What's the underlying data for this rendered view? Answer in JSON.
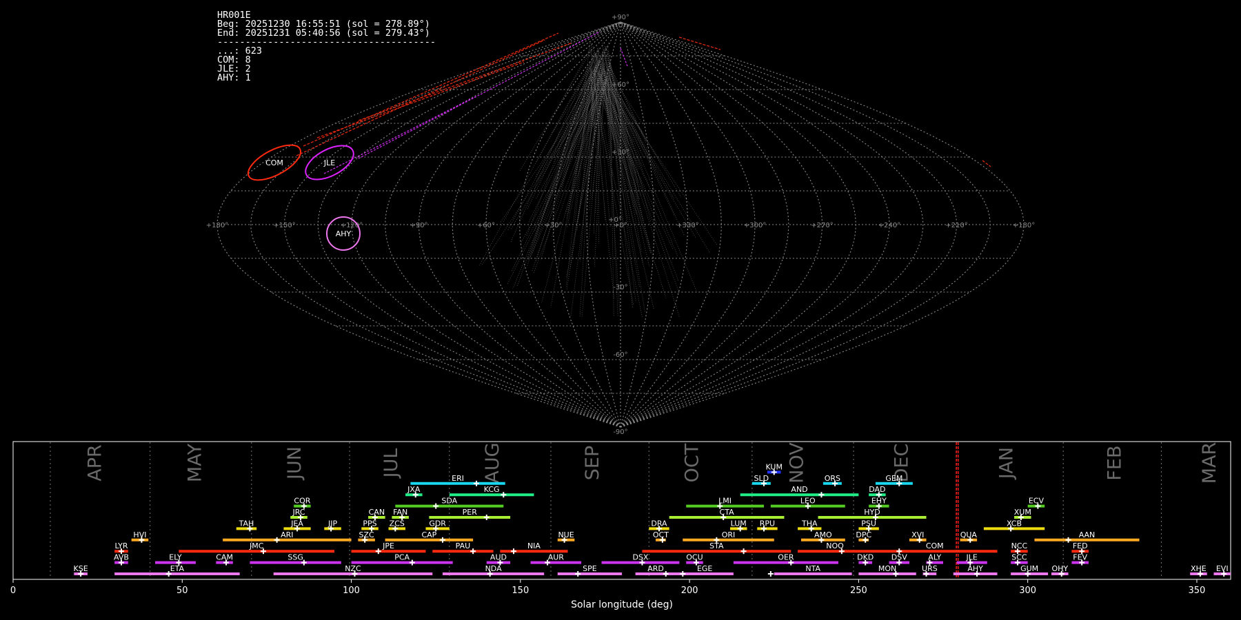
{
  "stats": {
    "lines": [
      "HR001E",
      "Beg: 20251230 16:55:51 (sol = 278.89°)",
      "End: 20251231 05:40:56 (sol = 279.43°)",
      "---------------------------------------",
      "...: 623",
      "COM: 8",
      "JLE: 2",
      "AHY: 1"
    ]
  },
  "chart_data": [
    {
      "type": "sky-map-sinusoidal",
      "lat_ticks": [
        "+90°",
        "+60°",
        "+30°",
        "+0°",
        "-30°",
        "-60°",
        "-90°"
      ],
      "lon_ticks": [
        "+180°",
        "+150°",
        "+120°",
        "+90°",
        "+60°",
        "+30°",
        "+0°",
        "+330°",
        "+300°",
        "+270°",
        "+240°",
        "+210°",
        "+180°"
      ],
      "grid": true,
      "radiants": [
        {
          "code": "COM",
          "color": "#ff2a10"
        },
        {
          "code": "JLE",
          "color": "#dd22ff"
        },
        {
          "code": "AHY",
          "color": "#ee77ee"
        }
      ]
    },
    {
      "type": "timeline",
      "xlabel": "Solar longitude (deg)",
      "xlim": [
        0,
        360
      ],
      "xticks": [
        0,
        50,
        100,
        150,
        200,
        250,
        300,
        350
      ],
      "current_marker": [
        278.89,
        279.43
      ],
      "months": [
        {
          "name": "APR",
          "center": 24.5
        },
        {
          "name": "MAY",
          "center": 54
        },
        {
          "name": "JUN",
          "center": 83.5
        },
        {
          "name": "JUL",
          "center": 112
        },
        {
          "name": "AUG",
          "center": 142
        },
        {
          "name": "SEP",
          "center": 171.5
        },
        {
          "name": "OCT",
          "center": 201
        },
        {
          "name": "NOV",
          "center": 232
        },
        {
          "name": "DEC",
          "center": 263
        },
        {
          "name": "JAN",
          "center": 294
        },
        {
          "name": "FEB",
          "center": 326
        },
        {
          "name": "MAR",
          "center": 354
        }
      ],
      "month_boundaries": [
        11,
        40.5,
        70.5,
        99.5,
        129,
        159,
        188,
        218.5,
        248.5,
        279,
        310.5,
        339.5
      ],
      "showers": [
        {
          "code": "KUM",
          "row": 9,
          "start": 223,
          "end": 227,
          "peak": 225,
          "color": "#2233ff"
        },
        {
          "code": "ERI",
          "row": 8,
          "start": 117.5,
          "end": 145.5,
          "peak": 137,
          "color": "#18d8f0"
        },
        {
          "code": "SLD",
          "row": 8,
          "start": 218.5,
          "end": 224,
          "peak": 222,
          "color": "#18d8f0"
        },
        {
          "code": "ORS",
          "row": 8,
          "start": 239.5,
          "end": 245,
          "peak": 243,
          "color": "#18d8f0"
        },
        {
          "code": "GEM",
          "row": 8,
          "start": 255,
          "end": 266,
          "peak": 262,
          "color": "#18d8f0"
        },
        {
          "code": "JXA",
          "row": 7,
          "start": 116,
          "end": 121,
          "peak": 119,
          "color": "#22ee88"
        },
        {
          "code": "KCG",
          "row": 7,
          "start": 129,
          "end": 154,
          "peak": 145,
          "color": "#22ee88"
        },
        {
          "code": "AND",
          "row": 7,
          "start": 215,
          "end": 250,
          "peak": 239,
          "color": "#22ee88"
        },
        {
          "code": "DAD",
          "row": 7,
          "start": 253,
          "end": 258,
          "peak": 256,
          "color": "#22ee88"
        },
        {
          "code": "COR",
          "row": 6,
          "start": 83,
          "end": 88,
          "peak": 86,
          "color": "#55cc22"
        },
        {
          "code": "SDA",
          "row": 6,
          "start": 113,
          "end": 145,
          "peak": 125,
          "color": "#55cc22"
        },
        {
          "code": "LMI",
          "row": 6,
          "start": 199,
          "end": 222,
          "peak": 209,
          "color": "#55cc22"
        },
        {
          "code": "LEO",
          "row": 6,
          "start": 224,
          "end": 246,
          "peak": 235,
          "color": "#55cc22"
        },
        {
          "code": "EHY",
          "row": 6,
          "start": 253,
          "end": 259,
          "peak": 256,
          "color": "#55cc22"
        },
        {
          "code": "ECV",
          "row": 6,
          "start": 300,
          "end": 305,
          "peak": 303,
          "color": "#55cc22"
        },
        {
          "code": "JRC",
          "row": 5,
          "start": 82,
          "end": 87,
          "peak": 85,
          "color": "#aaee33"
        },
        {
          "code": "CAN",
          "row": 5,
          "start": 105,
          "end": 110,
          "peak": 107,
          "color": "#aaee33"
        },
        {
          "code": "FAN",
          "row": 5,
          "start": 112,
          "end": 117,
          "peak": 115,
          "color": "#aaee33"
        },
        {
          "code": "PER",
          "row": 5,
          "start": 123,
          "end": 147,
          "peak": 140,
          "color": "#aaee33"
        },
        {
          "code": "CTA",
          "row": 5,
          "start": 194,
          "end": 228,
          "peak": 210,
          "color": "#aaee33"
        },
        {
          "code": "HYD",
          "row": 5,
          "start": 238,
          "end": 270,
          "peak": 255,
          "color": "#aaee33"
        },
        {
          "code": "XUM",
          "row": 5,
          "start": 296,
          "end": 301,
          "peak": 298,
          "color": "#aaee33"
        },
        {
          "code": "TAH",
          "row": 4,
          "start": 66,
          "end": 72,
          "peak": 70,
          "color": "#eedd11"
        },
        {
          "code": "JEA",
          "row": 4,
          "start": 80,
          "end": 88,
          "peak": 84,
          "color": "#eedd11"
        },
        {
          "code": "JIP",
          "row": 4,
          "start": 92,
          "end": 97,
          "peak": 94,
          "color": "#eedd11"
        },
        {
          "code": "PPS",
          "row": 4,
          "start": 103,
          "end": 108,
          "peak": 106,
          "color": "#eedd11"
        },
        {
          "code": "ZCS",
          "row": 4,
          "start": 111,
          "end": 116,
          "peak": 113,
          "color": "#eedd11"
        },
        {
          "code": "GDR",
          "row": 4,
          "start": 122,
          "end": 129,
          "peak": 125,
          "color": "#eedd11"
        },
        {
          "code": "DRA",
          "row": 4,
          "start": 188,
          "end": 194,
          "peak": 191,
          "color": "#eedd11"
        },
        {
          "code": "LUM",
          "row": 4,
          "start": 212,
          "end": 217,
          "peak": 215,
          "color": "#eedd11"
        },
        {
          "code": "RPU",
          "row": 4,
          "start": 220,
          "end": 226,
          "peak": 222,
          "color": "#eedd11"
        },
        {
          "code": "THA",
          "row": 4,
          "start": 232,
          "end": 239,
          "peak": 236,
          "color": "#eedd11"
        },
        {
          "code": "PSU",
          "row": 4,
          "start": 250,
          "end": 256,
          "peak": 253,
          "color": "#eedd11"
        },
        {
          "code": "XCB",
          "row": 4,
          "start": 287,
          "end": 305,
          "peak": 295,
          "color": "#eedd11"
        },
        {
          "code": "HVI",
          "row": 3,
          "start": 35,
          "end": 40,
          "peak": 38,
          "color": "#ffaa22"
        },
        {
          "code": "ARI",
          "row": 3,
          "start": 62,
          "end": 100,
          "peak": 78,
          "color": "#ffaa22"
        },
        {
          "code": "SZC",
          "row": 3,
          "start": 102,
          "end": 107,
          "peak": 104,
          "color": "#ffaa22"
        },
        {
          "code": "CAP",
          "row": 3,
          "start": 110,
          "end": 136,
          "peak": 127,
          "color": "#ffaa22"
        },
        {
          "code": "NUE",
          "row": 3,
          "start": 161,
          "end": 166,
          "peak": 163,
          "color": "#ffaa22"
        },
        {
          "code": "OCT",
          "row": 3,
          "start": 190,
          "end": 193,
          "peak": 192,
          "color": "#ffaa22"
        },
        {
          "code": "ORI",
          "row": 3,
          "start": 198,
          "end": 225,
          "peak": 208,
          "color": "#ffaa22"
        },
        {
          "code": "AMO",
          "row": 3,
          "start": 233,
          "end": 246,
          "peak": 239,
          "color": "#ffaa22"
        },
        {
          "code": "DPC",
          "row": 3,
          "start": 250,
          "end": 253,
          "peak": 252,
          "color": "#ffaa22"
        },
        {
          "code": "XVI",
          "row": 3,
          "start": 265,
          "end": 270,
          "peak": 268,
          "color": "#ffaa22"
        },
        {
          "code": "QUA",
          "row": 3,
          "start": 280,
          "end": 285,
          "peak": 283,
          "color": "#ffaa22"
        },
        {
          "code": "AAN",
          "row": 3,
          "start": 302,
          "end": 333,
          "peak": 312,
          "color": "#ffaa22"
        },
        {
          "code": "LYR",
          "row": 2,
          "start": 30,
          "end": 34,
          "peak": 32,
          "color": "#ff2a10"
        },
        {
          "code": "JMC",
          "row": 2,
          "start": 49,
          "end": 95,
          "peak": 74,
          "color": "#ff2a10"
        },
        {
          "code": "JPE",
          "row": 2,
          "start": 100,
          "end": 122,
          "peak": 108,
          "color": "#ff2a10"
        },
        {
          "code": "PAU",
          "row": 2,
          "start": 124,
          "end": 142,
          "peak": 136,
          "color": "#ff2a10"
        },
        {
          "code": "NIA",
          "row": 2,
          "start": 144,
          "end": 164,
          "peak": 148,
          "color": "#ff2a10"
        },
        {
          "code": "STA",
          "row": 2,
          "start": 186,
          "end": 230,
          "peak": 216,
          "color": "#ff2a10"
        },
        {
          "code": "NOO",
          "row": 2,
          "start": 232,
          "end": 254,
          "peak": 245,
          "color": "#ff2a10"
        },
        {
          "code": "COM",
          "row": 2,
          "start": 254,
          "end": 291,
          "peak": 262,
          "color": "#ff2a10"
        },
        {
          "code": "NCC",
          "row": 2,
          "start": 295,
          "end": 300,
          "peak": 297,
          "color": "#ff2a10"
        },
        {
          "code": "FED",
          "row": 2,
          "start": 313,
          "end": 318,
          "peak": 316,
          "color": "#ff2a10"
        },
        {
          "code": "AVB",
          "row": 1,
          "start": 30,
          "end": 34,
          "peak": 32,
          "color": "#cc33ee"
        },
        {
          "code": "ELY",
          "row": 1,
          "start": 42,
          "end": 54,
          "peak": 49,
          "color": "#cc33ee"
        },
        {
          "code": "CAM",
          "row": 1,
          "start": 60,
          "end": 65,
          "peak": 63,
          "color": "#cc33ee"
        },
        {
          "code": "SSG",
          "row": 1,
          "start": 70,
          "end": 97,
          "peak": 86,
          "color": "#cc33ee"
        },
        {
          "code": "PCA",
          "row": 1,
          "start": 100,
          "end": 130,
          "peak": 118,
          "color": "#cc33ee"
        },
        {
          "code": "AUD",
          "row": 1,
          "start": 140,
          "end": 147,
          "peak": 144,
          "color": "#cc33ee"
        },
        {
          "code": "AUR",
          "row": 1,
          "start": 153,
          "end": 168,
          "peak": 158,
          "color": "#cc33ee"
        },
        {
          "code": "DSX",
          "row": 1,
          "start": 174,
          "end": 197,
          "peak": 186,
          "color": "#cc33ee"
        },
        {
          "code": "OCU",
          "row": 1,
          "start": 199,
          "end": 204,
          "peak": 202,
          "color": "#cc33ee"
        },
        {
          "code": "OER",
          "row": 1,
          "start": 213,
          "end": 244,
          "peak": 230,
          "color": "#cc33ee"
        },
        {
          "code": "DKD",
          "row": 1,
          "start": 250,
          "end": 254,
          "peak": 252,
          "color": "#cc33ee"
        },
        {
          "code": "DSV",
          "row": 1,
          "start": 259,
          "end": 265,
          "peak": 262,
          "color": "#cc33ee"
        },
        {
          "code": "ALY",
          "row": 1,
          "start": 270,
          "end": 275,
          "peak": 271,
          "color": "#cc33ee"
        },
        {
          "code": "JLE",
          "row": 1,
          "start": 279,
          "end": 288,
          "peak": 283,
          "color": "#cc33ee"
        },
        {
          "code": "SCC",
          "row": 1,
          "start": 295,
          "end": 300,
          "peak": 297,
          "color": "#cc33ee"
        },
        {
          "code": "FEV",
          "row": 1,
          "start": 313,
          "end": 318,
          "peak": 316,
          "color": "#cc33ee"
        },
        {
          "code": "KSE",
          "row": 0,
          "start": 18,
          "end": 22,
          "peak": 20,
          "color": "#ee77ee"
        },
        {
          "code": "ETA",
          "row": 0,
          "start": 30,
          "end": 67,
          "peak": 46,
          "color": "#ee77ee"
        },
        {
          "code": "NZC",
          "row": 0,
          "start": 77,
          "end": 124,
          "peak": 101,
          "color": "#ee77ee"
        },
        {
          "code": "NDA",
          "row": 0,
          "start": 127,
          "end": 157,
          "peak": 141,
          "color": "#ee77ee"
        },
        {
          "code": "SPE",
          "row": 0,
          "start": 161,
          "end": 180,
          "peak": 167,
          "color": "#ee77ee"
        },
        {
          "code": "ARD",
          "row": 0,
          "start": 184,
          "end": 196,
          "peak": 193,
          "color": "#ee77ee"
        },
        {
          "code": "EGE",
          "row": 0,
          "start": 196,
          "end": 213,
          "peak": 198,
          "color": "#ee77ee"
        },
        {
          "code": "NTA",
          "row": 0,
          "start": 225,
          "end": 248,
          "peak": 224,
          "color": "#ee77ee"
        },
        {
          "code": "MON",
          "row": 0,
          "start": 250,
          "end": 267,
          "peak": 261,
          "color": "#ee77ee"
        },
        {
          "code": "URS",
          "row": 0,
          "start": 269,
          "end": 273,
          "peak": 270,
          "color": "#ee77ee"
        },
        {
          "code": "AHY",
          "row": 0,
          "start": 278,
          "end": 291,
          "peak": 285,
          "color": "#ee77ee"
        },
        {
          "code": "GUM",
          "row": 0,
          "start": 295,
          "end": 306,
          "peak": 300,
          "color": "#ee77ee"
        },
        {
          "code": "OHY",
          "row": 0,
          "start": 307,
          "end": 312,
          "peak": 310,
          "color": "#ee77ee"
        },
        {
          "code": "XHE",
          "row": 0,
          "start": 348,
          "end": 353,
          "peak": 351,
          "color": "#ee77ee"
        },
        {
          "code": "EVI",
          "row": 0,
          "start": 355,
          "end": 360,
          "peak": 358,
          "color": "#ee77ee"
        }
      ]
    }
  ]
}
